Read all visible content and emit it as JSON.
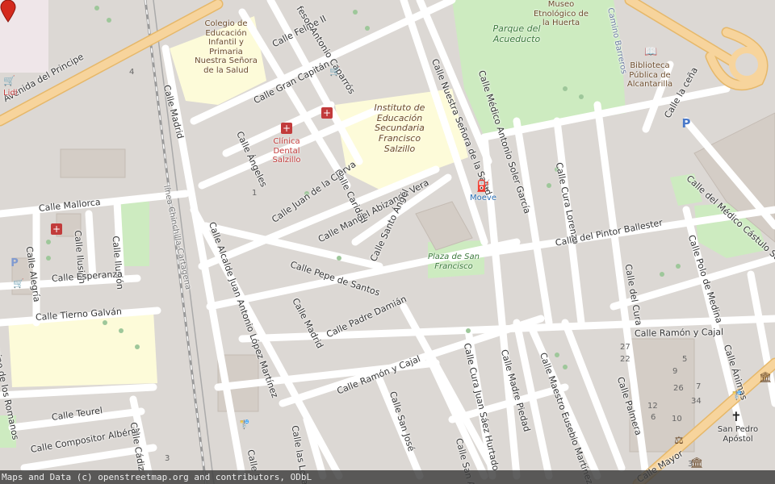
{
  "map": {
    "streets": {
      "avenida_principe": "Avenida del Principe",
      "calle_madrid_top": "Calle Madrid",
      "calle_felipe_ii": "Calle Felipe II",
      "calle_profesor": "fesor Antonio Caparrós",
      "calle_gran_capitan": "Calle Gran Capitán",
      "calle_angeles": "Calle Ángeles",
      "calle_caridad": "Calle Caridad",
      "calle_juan_cierva": "Calle Juan de la Cierva",
      "calle_manuel_abizanda": "Calle Manuel Abizanda Vera",
      "calle_santo_angel": "Calle Santo Ángel",
      "calle_pepe_santos": "Calle Pepe de Santos",
      "calle_padre_damian": "Calle Padre Damián",
      "calle_mallorca": "Calle Mallorca",
      "calle_alegria": "Calle Alegría",
      "calle_ilusion_1": "Calle Ilusión",
      "calle_ilusion_2": "Calle Ilusión",
      "calle_esperanza": "Calle Esperanza",
      "calle_tierno_galvan": "Calle Tierno Galván",
      "camino_romanos": "Camino de los Romanos",
      "calle_teurel": "Calle Teurel",
      "calle_compositor": "Calle Compositor Albéniz",
      "calle_cadiz": "Calle Cádiz",
      "calle_alcalde": "Calle Alcalde Juan Antonio López Martínez",
      "calle_madrid_mid": "Calle Madrid",
      "calle_ramon_cajal_1": "Calle Ramón y Cajal",
      "calle_ramon_cajal_2": "Calle Ramón y Cajal",
      "calle_san_jose": "Calle San José",
      "calle_cura_juan": "Calle Cura Juan Sáez Hurtado",
      "calle_madre_piedad": "Calle Madre Piedad",
      "calle_maestro": "Calle Maestro Eusebio Martínez",
      "calle_nuestra_senora": "Calle Nuestra Señora de la Salud",
      "calle_medico_antonio": "Calle Médico Antonio Soler García",
      "calle_cura_lorenzo": "Calle Cura Lorenzo",
      "calle_pintor_ballester": "Calle del Pintor Ballester",
      "calle_del_cura": "Calle del Cura",
      "calle_polo_medina": "Calle Polo de Medina",
      "calle_medico_castulo": "Calle del Médico Cástulo Sar",
      "calle_la_cena": "Calle la ceña",
      "calle_palmera": "Calle Palmera",
      "calle_animas": "Calle Ánimas",
      "calle_mayor": "Calle Mayor",
      "calle_las_losas": "Calle las Losa",
      "calle_san_a": "Calle San A",
      "calle_e": "Calle E",
      "linea": "línea Chinchilla-Cartagena",
      "barreros": "Camino Barreros"
    },
    "pois": {
      "colegio": "Colegio de Educación Infantil y Primaria Nuestra Señora de la Salud",
      "instituto": "Instituto de Educación Secundaria Francisco Salzillo",
      "clinica": "Clínica Dental Salzillo",
      "parque": "Parque del Acueducto",
      "museo": "Museo Etnológico de la Huerta",
      "biblioteca": "Biblioteca Pública de Alcantarilla",
      "plaza": "Plaza de San Francisco",
      "moeve": "Moeve",
      "lidl": "Lidl",
      "san_pedro": "San Pedro Apóstol"
    },
    "house_numbers": [
      "27",
      "22",
      "4",
      "3",
      "12",
      "9",
      "26",
      "34",
      "6",
      "10",
      "7",
      "5",
      "1",
      "3"
    ],
    "marker": {
      "label": "location-marker",
      "color": "#d42a1e"
    },
    "colors": {
      "road": "#ffffff",
      "major_road": "#f7d49c",
      "school": "#fdfbd9",
      "park": "#cdebc0",
      "building": "#d4cdc6",
      "background": "#dcd8d4"
    }
  },
  "attribution": "Maps and Data (c) openstreetmap.org and contributors, ODbL"
}
